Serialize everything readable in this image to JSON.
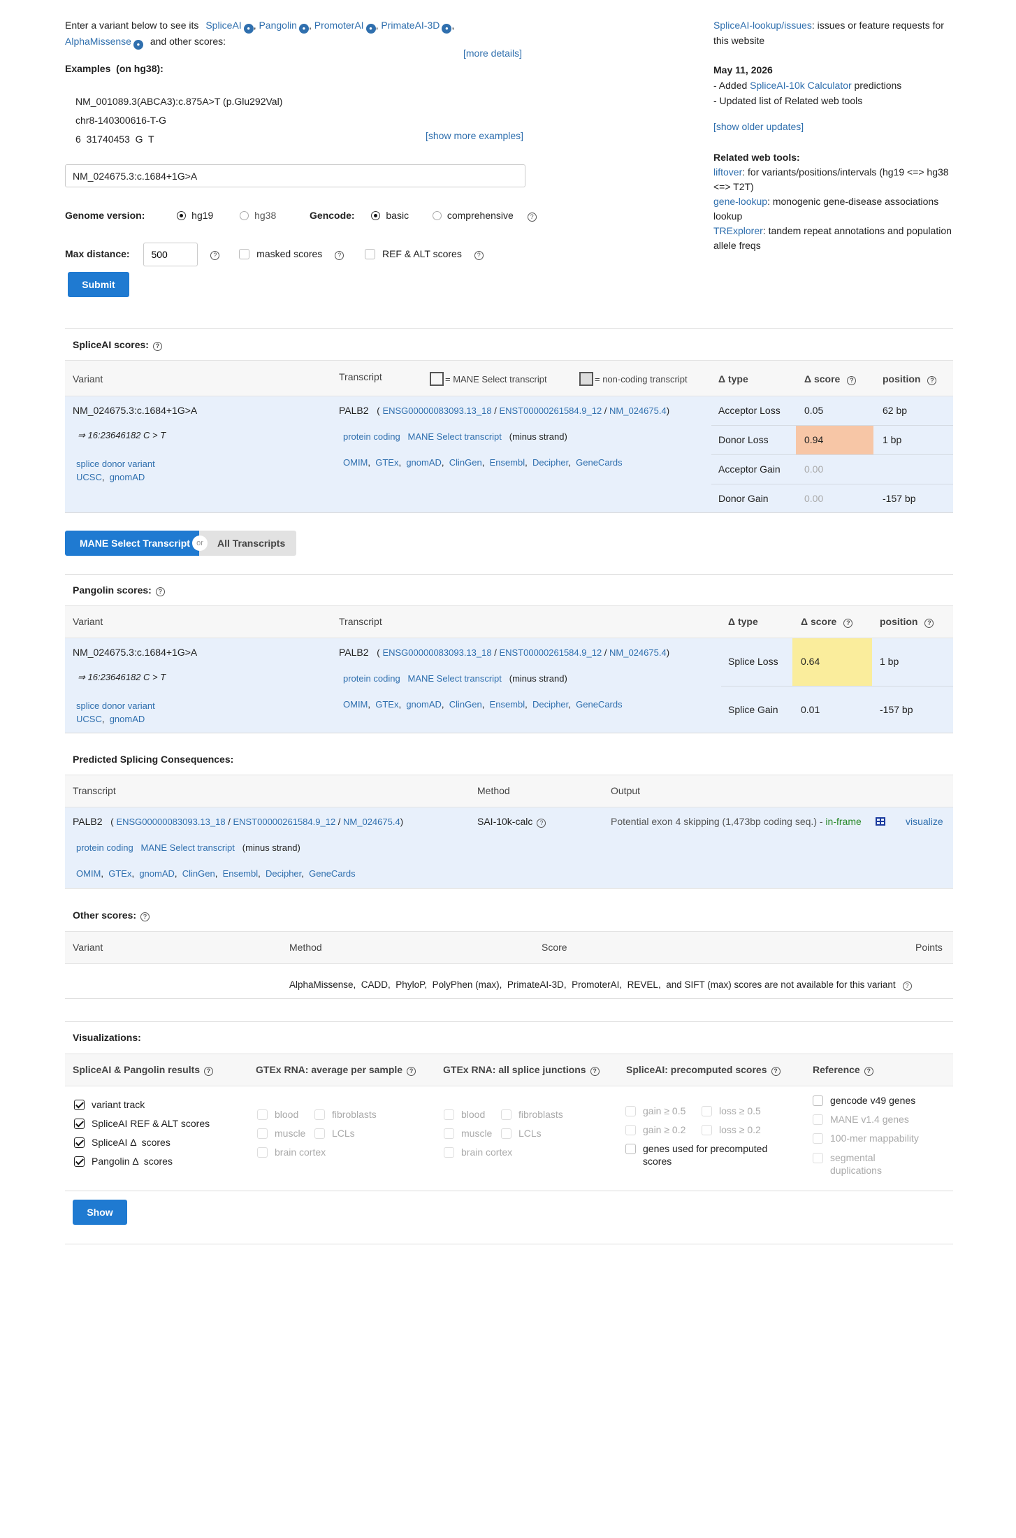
{
  "intro": {
    "prefix": "Enter a variant below to see its",
    "links": [
      "SpliceAI",
      "Pangolin",
      "PromoterAI",
      "PrimateAI-3D"
    ],
    "link_last": "AlphaMissense",
    "suffix": "and other scores:",
    "more_details": "[more details]"
  },
  "examples": {
    "title": "Examples",
    "subtitle": "(on hg38):",
    "items": [
      "NM_001089.3(ABCA3):c.875A>T (p.Glu292Val)",
      "chr8-140300616-T-G",
      "6  31740453  G  T"
    ],
    "show_more": "[show more examples]"
  },
  "form": {
    "variant_value": "NM_024675.3:c.1684+1G>A",
    "genome_label": "Genome version:",
    "genome_options": [
      "hg19",
      "hg38"
    ],
    "gencode_label": "Gencode:",
    "gencode_options": [
      "basic",
      "comprehensive"
    ],
    "max_distance_label": "Max distance:",
    "max_distance_value": "500",
    "masked_label": "masked scores",
    "refalt_label": "REF & ALT scores",
    "submit": "Submit"
  },
  "sidebar": {
    "issues_link": "SpliceAI-lookup/issues",
    "issues_text": ": issues or feature requests for this website",
    "update_date": "May 11, 2026",
    "update1_prefix": "- Added ",
    "update1_link": "SpliceAI-10k Calculator",
    "update1_suffix": " predictions",
    "update2": "- Updated list of Related web tools",
    "show_older": "[show older updates]",
    "related_title": "Related web tools:",
    "tools": [
      {
        "name": "liftover",
        "desc": ": for variants/positions/intervals (hg19 <=> hg38 <=> T2T)"
      },
      {
        "name": "gene-lookup",
        "desc": ": monogenic gene-disease associations lookup"
      },
      {
        "name": "TRExplorer",
        "desc": ": tandem repeat annotations and population allele freqs"
      }
    ]
  },
  "common": {
    "variant": "NM_024675.3:c.1684+1G>A",
    "coord": "⇒ 16:23646182 C > T",
    "consequence": "splice donor variant",
    "ucsc": "UCSC",
    "gnomad": "gnomAD",
    "gene": "PALB2",
    "ensg": "ENSG00000083093.13_18",
    "enst": "ENST00000261584.9_12",
    "nm": "NM_024675.4",
    "biotype": "protein coding",
    "mane": "MANE Select transcript",
    "strand": "(minus strand)",
    "db_links": [
      "OMIM",
      "GTEx",
      "gnomAD",
      "ClinGen",
      "Ensembl",
      "Decipher",
      "GeneCards"
    ]
  },
  "spliceai": {
    "title": "SpliceAI scores:",
    "headers": {
      "variant": "Variant",
      "transcript": "Transcript",
      "mane_legend": "= MANE Select transcript",
      "noncoding_legend": "= non-coding transcript",
      "type": "Δ type",
      "score": "Δ score",
      "position": "position"
    },
    "rows": [
      {
        "type": "Acceptor Loss",
        "score": "0.05",
        "position": "62 bp"
      },
      {
        "type": "Donor Loss",
        "score": "0.94",
        "position": "1 bp"
      },
      {
        "type": "Acceptor Gain",
        "score": "0.00",
        "position": ""
      },
      {
        "type": "Donor Gain",
        "score": "0.00",
        "position": "-157 bp"
      }
    ]
  },
  "toggle": {
    "mane": "MANE Select Transcript",
    "or": "or",
    "all": "All Transcripts"
  },
  "pangolin": {
    "title": "Pangolin scores:",
    "headers": {
      "variant": "Variant",
      "transcript": "Transcript",
      "type": "Δ type",
      "score": "Δ score",
      "position": "position"
    },
    "rows": [
      {
        "type": "Splice Loss",
        "score": "0.64",
        "position": "1 bp"
      },
      {
        "type": "Splice Gain",
        "score": "0.01",
        "position": "-157 bp"
      }
    ]
  },
  "consequences": {
    "title": "Predicted Splicing Consequences:",
    "headers": {
      "transcript": "Transcript",
      "method": "Method",
      "output": "Output"
    },
    "method": "SAI-10k-calc",
    "output": "Potential exon 4 skipping (1,473bp coding seq.) - ",
    "inframe": "in-frame",
    "visualize": "visualize"
  },
  "other": {
    "title": "Other scores:",
    "headers": {
      "variant": "Variant",
      "method": "Method",
      "score": "Score",
      "points": "Points"
    },
    "message": "AlphaMissense,  CADD,  PhyloP,  PolyPhen (max),  PrimateAI-3D,  PromoterAI,  REVEL,  and SIFT (max) scores are not available for this variant"
  },
  "viz": {
    "title": "Visualizations:",
    "headers": [
      "SpliceAI & Pangolin results",
      "GTEx RNA: average per sample",
      "GTEx RNA: all splice junctions",
      "SpliceAI: precomputed scores",
      "Reference"
    ],
    "col1": [
      "variant track",
      "SpliceAI REF & ALT scores",
      "SpliceAI Δ  scores",
      "Pangolin Δ  scores"
    ],
    "gtex_a": [
      "blood",
      "fibroblasts",
      "muscle",
      "LCLs",
      "brain cortex"
    ],
    "precomp": [
      "gain ≥ 0.5",
      "loss ≥ 0.5",
      "gain ≥ 0.2",
      "loss ≥ 0.2",
      "genes used for precomputed scores"
    ],
    "reference": [
      "gencode v49 genes",
      "MANE v1.4 genes",
      "100-mer mappability",
      "segmental duplications"
    ],
    "show": "Show"
  },
  "colors": {
    "link": "#2f6fae",
    "button": "#1f7ad1",
    "donor_loss_bg": "#f7c6a6",
    "splice_loss_bg": "#faed9c",
    "row_bg": "#e8f0fb"
  }
}
